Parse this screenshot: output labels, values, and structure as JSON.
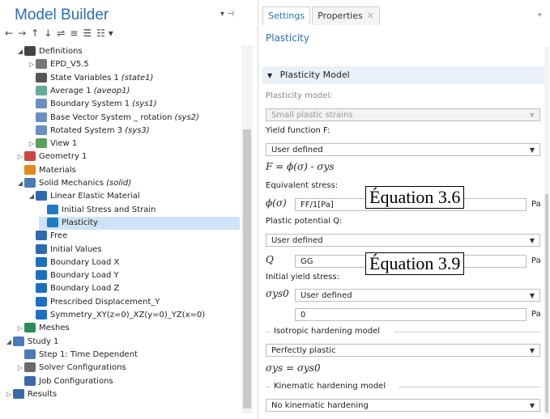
{
  "model_builder": {
    "title": "Model Builder",
    "window_controls": "▾ ⊣",
    "toolbar": [
      "←",
      "→",
      "↑",
      "↓",
      "⇌",
      "≡",
      "☰",
      "☷ ▾"
    ],
    "tree": [
      {
        "label": "Definitions",
        "note": "",
        "level": 1,
        "expanded": true,
        "icon": "definitions-icon"
      },
      {
        "label": "EPD_V5.5",
        "note": "",
        "level": 2,
        "expanded": false,
        "icon": "parameters-icon"
      },
      {
        "label": "State Variables 1",
        "note": "(state1)",
        "level": 2,
        "icon": "state-variables-icon"
      },
      {
        "label": "Average 1",
        "note": "(aveop1)",
        "level": 2,
        "icon": "average-icon"
      },
      {
        "label": "Boundary System 1",
        "note": "(sys1)",
        "level": 2,
        "icon": "boundary-system-icon"
      },
      {
        "label": "Base Vector System _ rotation",
        "note": "(sys2)",
        "level": 2,
        "icon": "base-vector-icon"
      },
      {
        "label": "Rotated System 3",
        "note": "(sys3)",
        "level": 2,
        "icon": "rotated-system-icon"
      },
      {
        "label": "View 1",
        "note": "",
        "level": 2,
        "expanded": false,
        "icon": "view-icon"
      },
      {
        "label": "Geometry 1",
        "note": "",
        "level": 1,
        "expanded": false,
        "icon": "geometry-icon"
      },
      {
        "label": "Materials",
        "note": "",
        "level": 1,
        "icon": "materials-icon"
      },
      {
        "label": "Solid Mechanics",
        "note": "(solid)",
        "level": 1,
        "expanded": true,
        "icon": "solid-mechanics-icon"
      },
      {
        "label": "Linear Elastic Material",
        "note": "",
        "level": 2,
        "expanded": true,
        "icon": "linear-elastic-icon"
      },
      {
        "label": "Initial Stress and Strain",
        "note": "",
        "level": 3,
        "icon": "initial-stress-icon"
      },
      {
        "label": "Plasticity",
        "note": "",
        "level": 3,
        "selected": true,
        "icon": "plasticity-icon"
      },
      {
        "label": "Free",
        "note": "",
        "level": 2,
        "icon": "free-icon"
      },
      {
        "label": "Initial Values",
        "note": "",
        "level": 2,
        "icon": "initial-values-icon"
      },
      {
        "label": "Boundary Load X",
        "note": "",
        "level": 2,
        "icon": "boundary-load-icon"
      },
      {
        "label": "Boundary Load Y",
        "note": "",
        "level": 2,
        "icon": "boundary-load-icon"
      },
      {
        "label": "Boundary Load Z",
        "note": "",
        "level": 2,
        "icon": "boundary-load-icon"
      },
      {
        "label": "Prescribed Displacement_Y",
        "note": "",
        "level": 2,
        "icon": "prescribed-displacement-icon"
      },
      {
        "label": "Symmetry_XY(z=0)_XZ(y=0)_YZ(x=0)",
        "note": "",
        "level": 2,
        "icon": "symmetry-icon"
      },
      {
        "label": "Meshes",
        "note": "",
        "level": 1,
        "expanded": false,
        "icon": "meshes-icon"
      },
      {
        "label": "Study 1",
        "note": "",
        "level": 0,
        "expanded": true,
        "icon": "study-icon"
      },
      {
        "label": "Step 1: Time Dependent",
        "note": "",
        "level": 1,
        "icon": "time-dependent-icon"
      },
      {
        "label": "Solver Configurations",
        "note": "",
        "level": 1,
        "expanded": false,
        "icon": "solver-icon"
      },
      {
        "label": "Job Configurations",
        "note": "",
        "level": 1,
        "icon": "job-icon"
      },
      {
        "label": "Results",
        "note": "",
        "level": 0,
        "expanded": false,
        "icon": "results-icon"
      }
    ]
  },
  "settings": {
    "tabs": {
      "settings": "Settings",
      "properties": "Properties"
    },
    "panel_title": "Plasticity",
    "section": "Plasticity Model",
    "plasticity_model_label": "Plasticity model:",
    "plasticity_model_value": "Small plastic strains",
    "yield_function_label": "Yield function F:",
    "yield_function_value": "User defined",
    "yield_equation": "F = ϕ(σ) - σys",
    "equivalent_stress_label": "Equivalent stress:",
    "equivalent_stress_symbol": "ϕ(σ)",
    "equivalent_stress_value": "FF/1[Pa]",
    "equivalent_stress_unit": "Pa",
    "annotation_1": "Équation 3.6",
    "plastic_potential_label": "Plastic potential Q:",
    "plastic_potential_value": "User defined",
    "q_symbol": "Q",
    "q_value": "GG",
    "q_unit": "Pa",
    "annotation_2": "Équation 3.9",
    "initial_yield_label": "Initial yield stress:",
    "sigma_ys0_symbol": "σys0",
    "sigma_ys0_value": "User defined",
    "sigma_ys0_input": "0",
    "sigma_ys0_unit": "Pa",
    "isotropic_label": "Isotropic hardening model",
    "isotropic_value": "Perfectly plastic",
    "sigma_equation": "σys = σys0",
    "kinematic_label": "Kinematic hardening model",
    "kinematic_value": "No kinematic hardening"
  }
}
